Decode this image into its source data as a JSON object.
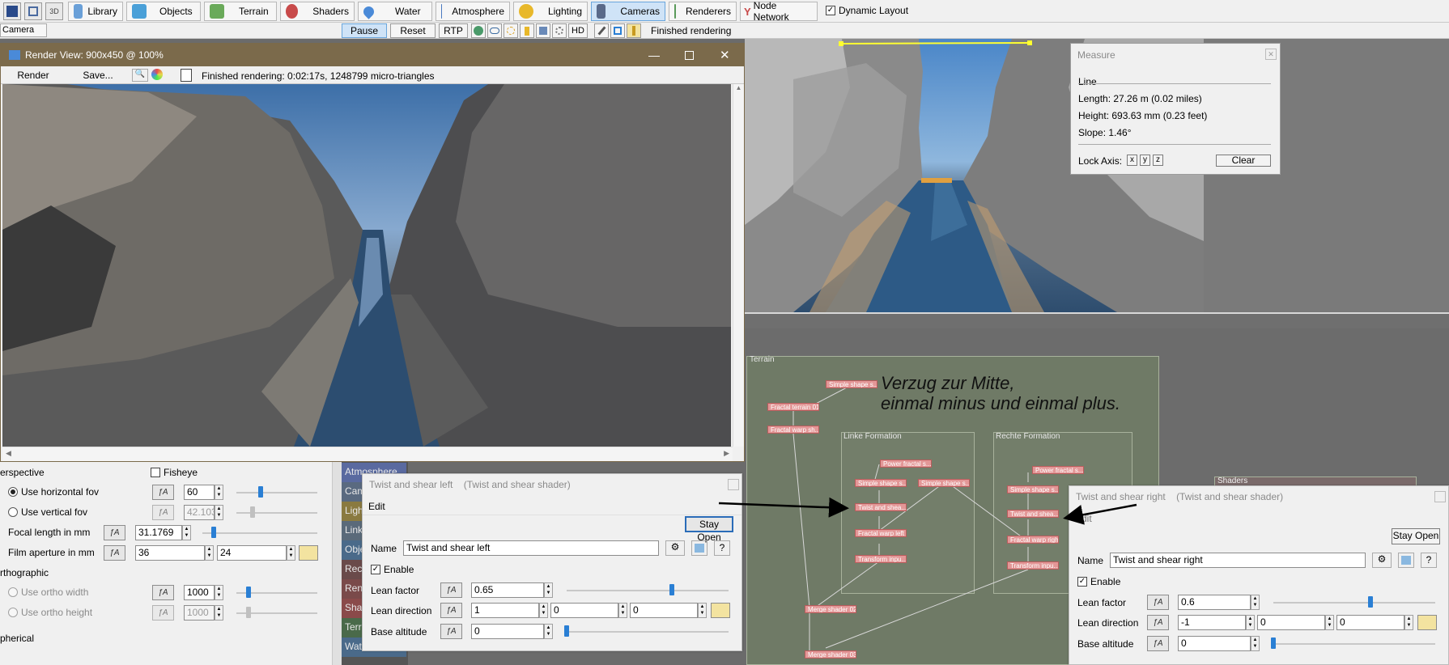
{
  "toolbar": {
    "buttons": [
      {
        "label": "Library",
        "icon": "books-icon",
        "color": "#6aa0d8"
      },
      {
        "label": "Objects",
        "icon": "cube-icon",
        "color": "#4aa0d8"
      },
      {
        "label": "Terrain",
        "icon": "terrain-icon",
        "color": "#6aaa5a"
      },
      {
        "label": "Shaders",
        "icon": "sphere-icon",
        "color": "#c84a4a"
      },
      {
        "label": "Water",
        "icon": "water-drop-icon",
        "color": "#4a8ad8"
      },
      {
        "label": "Atmosphere",
        "icon": "atmosphere-icon",
        "color": "#4a7ac0"
      },
      {
        "label": "Lighting",
        "icon": "sun-icon",
        "color": "#e8b82a"
      },
      {
        "label": "Cameras",
        "icon": "camera-icon",
        "color": "#5a6a8a"
      },
      {
        "label": "Renderers",
        "icon": "renderer-icon",
        "color": "#5a9a5a"
      },
      {
        "label": "Node Network",
        "icon": "node-network-icon",
        "color": "#c84a4a"
      }
    ],
    "dynamic_layout": "Dynamic Layout"
  },
  "row2": {
    "camera_tab": "Camera",
    "pause": "Pause",
    "reset": "Reset",
    "rtp": "RTP",
    "hd": "HD",
    "status": "Finished rendering"
  },
  "render_window": {
    "title": "Render View: 900x450 @ 100%",
    "render": "Render",
    "save": "Save...",
    "status": "Finished rendering:  0:02:17s, 1248799 micro-triangles"
  },
  "measure": {
    "title": "Measure",
    "mode": "Line",
    "length": "Length: 27.26 m  (0.02 miles)",
    "height": "Height: 693.63 mm  (0.23 feet)",
    "slope": "Slope: 1.46°",
    "lock_axis": "Lock Axis:",
    "x": "x",
    "y": "y",
    "z": "z",
    "clear": "Clear"
  },
  "camera_panel": {
    "perspective": "erspective",
    "fisheye": "Fisheye",
    "use_horizontal_fov": "Use horizontal fov",
    "use_vertical_fov": "Use vertical fov",
    "focal_length": "Focal length in mm",
    "film_aperture": "Film aperture in mm",
    "orthographic": "rthographic",
    "use_ortho_width": "Use ortho width",
    "use_ortho_height": "Use ortho height",
    "spherical": "pherical",
    "horizontal_fov_value": "60",
    "vertical_fov_value": "42.103",
    "focal_length_value": "31.1769",
    "film_aperture_w": "36",
    "film_aperture_h": "24",
    "ortho_width_value": "1000",
    "ortho_height_value": "1000",
    "horizontal_fov_level": 0.3,
    "vertical_fov_level": 0.2,
    "focal_length_level": 0.1,
    "ortho_width_level": 0.15,
    "ortho_height_level": 0.15
  },
  "side_tabs": [
    {
      "label": "Atmosphere",
      "color": "#5a6aa0"
    },
    {
      "label": "Cam",
      "color": "#5a6a80"
    },
    {
      "label": "Ligh",
      "color": "#8a7a40"
    },
    {
      "label": "Link",
      "color": "#5a6a7a"
    },
    {
      "label": "Obje",
      "color": "#4a6a8a"
    },
    {
      "label": "Rec",
      "color": "#6a4a4a"
    },
    {
      "label": "Ren",
      "color": "#7a4a4a"
    },
    {
      "label": "Sha",
      "color": "#8a4a4a"
    },
    {
      "label": "Terr",
      "color": "#4a6a4a"
    },
    {
      "label": "Wat",
      "color": "#4a6a8a"
    }
  ],
  "shader_left": {
    "title": "Twist and shear left",
    "subtitle": "(Twist and shear shader)",
    "menu_edit": "Edit",
    "stay_open": "Stay Open",
    "name_label": "Name",
    "name_value": "Twist and shear left",
    "enable": "Enable",
    "lean_factor": "Lean factor",
    "lean_factor_value": "0.65",
    "lean_factor_level": 0.65,
    "lean_direction": "Lean direction",
    "lean_dir_x": "1",
    "lean_dir_y": "0",
    "lean_dir_z": "0",
    "base_altitude": "Base altitude",
    "base_altitude_value": "0",
    "base_altitude_level": 0.0
  },
  "shader_right": {
    "title": "Twist and shear right",
    "subtitle": "(Twist and shear shader)",
    "menu_edit": "Edit",
    "stay_open": "Stay Open",
    "name_label": "Name",
    "name_value": "Twist and shear right",
    "enable": "Enable",
    "lean_factor": "Lean factor",
    "lean_factor_value": "0.6",
    "lean_factor_level": 0.6,
    "lean_direction": "Lean direction",
    "lean_dir_x": "-1",
    "lean_dir_y": "0",
    "lean_dir_z": "0",
    "base_altitude": "Base altitude",
    "base_altitude_value": "0",
    "base_altitude_level": 0.0
  },
  "node_network": {
    "terrain_label": "Terrain",
    "annotation_line1": "Verzug zur Mitte,",
    "annotation_line2": "einmal minus und einmal plus.",
    "linke_formation": "Linke Formation",
    "rechte_formation": "Rechte Formation",
    "shaders_label": "Shaders",
    "nodes": {
      "simple_shape_top": "Simple shape s...",
      "fractal_terrain": "Fractal terrain 01",
      "fractal_warp_sh": "Fractal warp sh...",
      "power_fractal_l": "Power fractal s...",
      "simple_shape_l1": "Simple shape s...",
      "simple_shape_l2": "Simple shape s...",
      "twist_shear_l": "Twist and shea...",
      "fractal_warp_left": "Fractal warp left",
      "transform_l": "Transform inpu...",
      "power_fractal_r": "Power fractal s...",
      "simple_shape_r": "Simple shape s...",
      "twist_shear_r": "Twist and shea...",
      "fractal_warp_right": "Fractal warp right",
      "transform_r": "Transform inpu...",
      "merge_02": "Merge shader 02",
      "merge_03": "Merge shader 03"
    }
  }
}
